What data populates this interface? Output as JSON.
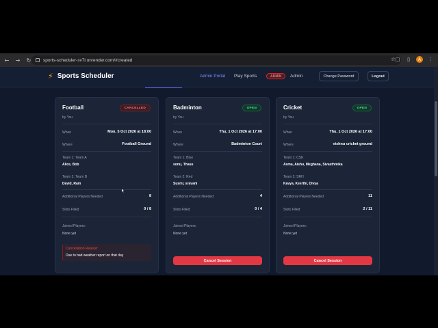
{
  "browser": {
    "url": "sports-scheduler-sv7l.onrender.com/#created",
    "profile_initial": "A"
  },
  "header": {
    "brand": "Sports Scheduler",
    "nav": {
      "admin_portal": "Admin Portal",
      "play_sports": "Play Sports",
      "admin_badge": "ADMIN",
      "admin_name": "Admin",
      "change_password": "Change Password",
      "logout": "Logout"
    }
  },
  "labels": {
    "when": "When",
    "where": "Where",
    "additional": "Additional Players Needed",
    "slots": "Slots Filled",
    "joined": "Joined Players:",
    "none_yet": "None yet",
    "cancellation_reason": "Cancellation Reason:",
    "cancel_session": "Cancel Session"
  },
  "cards": [
    {
      "sport": "Football",
      "by": "by You",
      "status": "CANCELLED",
      "when": "Mon, 5 Oct 2026 at 18:00",
      "where": "Football Ground",
      "team1_label": "Team 1: Team A",
      "team1_players": "Alice, Bob",
      "team2_label": "Team 2: Team B",
      "team2_players": "David, Ram",
      "additional": "8",
      "slots": "0 / 8",
      "reason": "Due to bad weather report on that day"
    },
    {
      "sport": "Badminton",
      "by": "by You",
      "status": "OPEN",
      "when": "Thu, 1 Oct 2026 at 17:00",
      "where": "Badminton Court",
      "team1_label": "Team 1: Blue",
      "team1_players": "sonu, Thasu",
      "team2_label": "Team 2: Red",
      "team2_players": "Susmi, sravani",
      "additional": "4",
      "slots": "0 / 4"
    },
    {
      "sport": "Cricket",
      "by": "by You",
      "status": "OPEN",
      "when": "Thu, 1 Oct 2026 at 17:00",
      "where": "vishnu cricket ground",
      "team1_label": "Team 1: CSK",
      "team1_players": "Asma, Aishu, Meghana, Sivasthmika",
      "team2_label": "Team 2: SRH",
      "team2_players": "Kavya, Keerthi, Divya",
      "additional": "11",
      "slots": "2 / 11"
    }
  ],
  "colors": {
    "accent": "#818cf8",
    "danger": "#e23844",
    "open": "#4ade80",
    "background": "#101a2c"
  }
}
